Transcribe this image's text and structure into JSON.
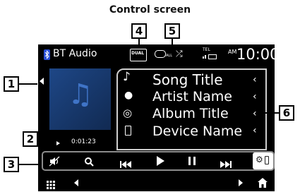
{
  "heading": "Control screen",
  "callouts": {
    "c1": "1",
    "c2": "2",
    "c3": "3",
    "c4": "4",
    "c5": "5",
    "c6": "6"
  },
  "header": {
    "source_label": "BT Audio",
    "dual_zone_label": "DUAL",
    "repeat_label": "ALL",
    "tel_label": "TEL",
    "ampm": "AM",
    "time": "10:00"
  },
  "play_time": "0:01:23",
  "info_rows": [
    {
      "icon": "music-note-icon",
      "text": "Song Title"
    },
    {
      "icon": "artist-icon",
      "text": "Artist Name"
    },
    {
      "icon": "album-icon",
      "text": "Album Title"
    },
    {
      "icon": "device-icon",
      "text": "Device Name"
    }
  ],
  "colors": {
    "accent": "#2a4fd6",
    "art_background": "#1b3d78",
    "bar_border": "#8c8c8c",
    "panel_border": "#cfcfcf"
  }
}
